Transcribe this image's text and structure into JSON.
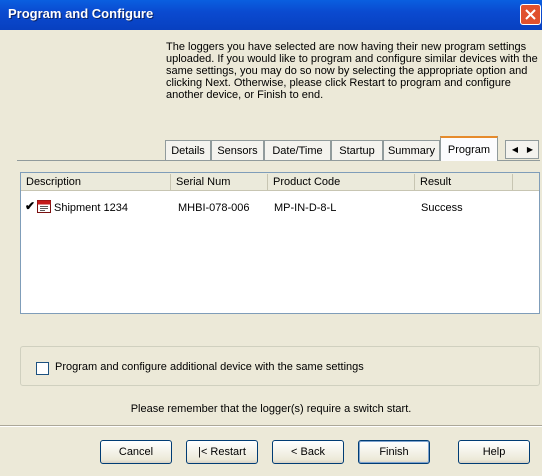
{
  "window": {
    "title": "Program and Configure"
  },
  "intro_text": "The loggers you have selected are now having their new program settings uploaded. If you would like to program and configure similar devices with the same settings, you may do so now by selecting the appropriate option and clicking Next. Otherwise, please click Restart to program and configure another device, or Finish to end.",
  "tabs": [
    {
      "label": "Details"
    },
    {
      "label": "Sensors"
    },
    {
      "label": "Date/Time"
    },
    {
      "label": "Startup"
    },
    {
      "label": "Summary"
    },
    {
      "label": "Program",
      "active": true
    }
  ],
  "tab_scroll": {
    "left": "◀",
    "right": "▶"
  },
  "list": {
    "columns": [
      "Description",
      "Serial Num",
      "Product Code",
      "Result"
    ],
    "rows": [
      {
        "description": "Shipment 1234",
        "serial": "MHBI-078-006",
        "product_code": "MP-IN-D-8-L",
        "result": "Success",
        "checked": "✔",
        "device_icon": "logger-device-icon"
      }
    ]
  },
  "option": {
    "label": "Program and configure additional device with the same settings",
    "checked": false
  },
  "notice": "Please remember that the logger(s) require a switch start.",
  "buttons": {
    "cancel": "Cancel",
    "restart": "|< Restart",
    "back": "< Back",
    "finish": "Finish",
    "help": "Help"
  },
  "colors": {
    "title_bar": "#0a4ad0",
    "dialog_bg": "#ece9d8",
    "active_tab_accent": "#e68b2c"
  }
}
